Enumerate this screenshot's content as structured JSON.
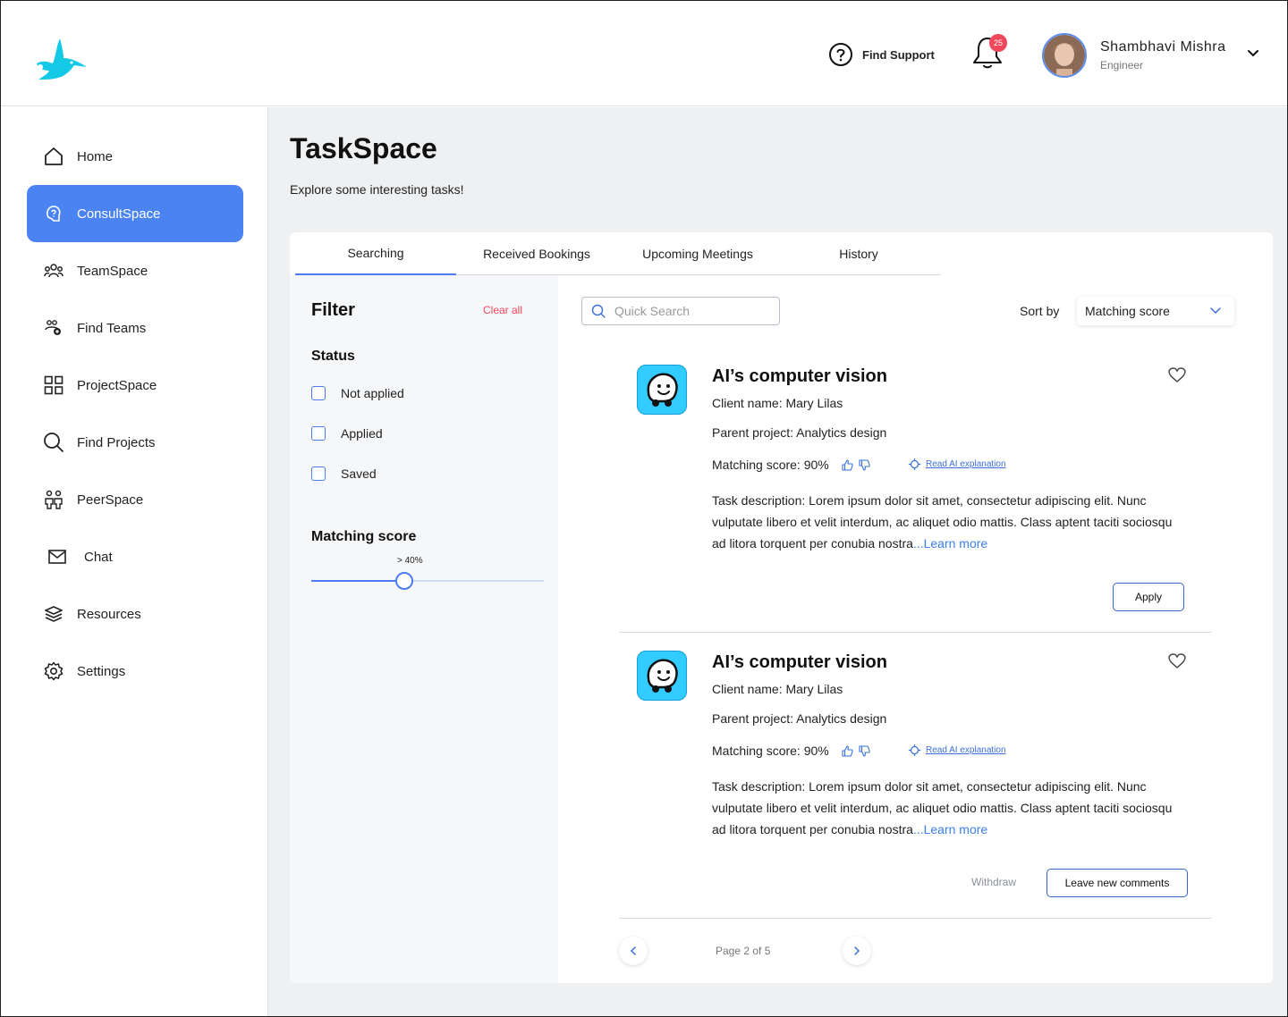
{
  "header": {
    "support_label": "Find Support",
    "notification_count": "25",
    "user_name": "Shambhavi Mishra",
    "user_role": "Engineer"
  },
  "sidebar": {
    "items": [
      {
        "label": "Home",
        "icon": "home-icon"
      },
      {
        "label": "ConsultSpace",
        "icon": "consult-icon",
        "active": true
      },
      {
        "label": "TeamSpace",
        "icon": "team-icon"
      },
      {
        "label": "Find Teams",
        "icon": "find-teams-icon"
      },
      {
        "label": "ProjectSpace",
        "icon": "grid-icon"
      },
      {
        "label": "Find Projects",
        "icon": "search-icon"
      },
      {
        "label": "PeerSpace",
        "icon": "peers-icon"
      },
      {
        "label": "Chat",
        "icon": "mail-icon"
      },
      {
        "label": "Resources",
        "icon": "layers-icon"
      },
      {
        "label": "Settings",
        "icon": "gear-icon"
      }
    ]
  },
  "page": {
    "title": "TaskSpace",
    "subtitle": "Explore some interesting tasks!"
  },
  "tabs": [
    "Searching",
    "Received Bookings",
    "Upcoming Meetings",
    "History"
  ],
  "filter": {
    "title": "Filter",
    "clear_all": "Clear all",
    "status_title": "Status",
    "status_options": [
      "Not applied",
      "Applied",
      "Saved"
    ],
    "score_title": "Matching score",
    "score_value_label": "> 40%",
    "score_value": 0.4
  },
  "search": {
    "placeholder": "Quick Search"
  },
  "sort": {
    "label": "Sort by",
    "value": "Matching score"
  },
  "tasks": [
    {
      "title": "AI’s computer vision",
      "client": "Client name: Mary Lilas",
      "parent": "Parent project: Analytics design",
      "score": "Matching score:  90%",
      "ai_link": "Read AI explanation",
      "description": "Task description: Lorem ipsum dolor sit amet, consectetur adipiscing elit. Nunc vulputate libero et velit interdum, ac aliquet odio mattis. Class aptent taciti sociosqu ad litora torquent per conubia nostra",
      "learn_more": "...Learn more",
      "apply_label": "Apply"
    },
    {
      "title": "AI’s computer vision",
      "client": "Client name: Mary Lilas",
      "parent": "Parent project: Analytics design",
      "score": "Matching score:  90%",
      "ai_link": "Read AI explanation",
      "description": "Task description: Lorem ipsum dolor sit amet, consectetur adipiscing elit. Nunc vulputate libero et velit interdum, ac aliquet odio mattis. Class aptent taciti sociosqu ad litora torquent per conubia nostra",
      "learn_more": "...Learn more",
      "withdraw_label": "Withdraw",
      "comment_label": "Leave new comments"
    }
  ],
  "pagination": {
    "text": "Page 2 of 5"
  },
  "colors": {
    "accent": "#4b84f2",
    "danger": "#f0475b",
    "app_icon": "#33ccff"
  }
}
